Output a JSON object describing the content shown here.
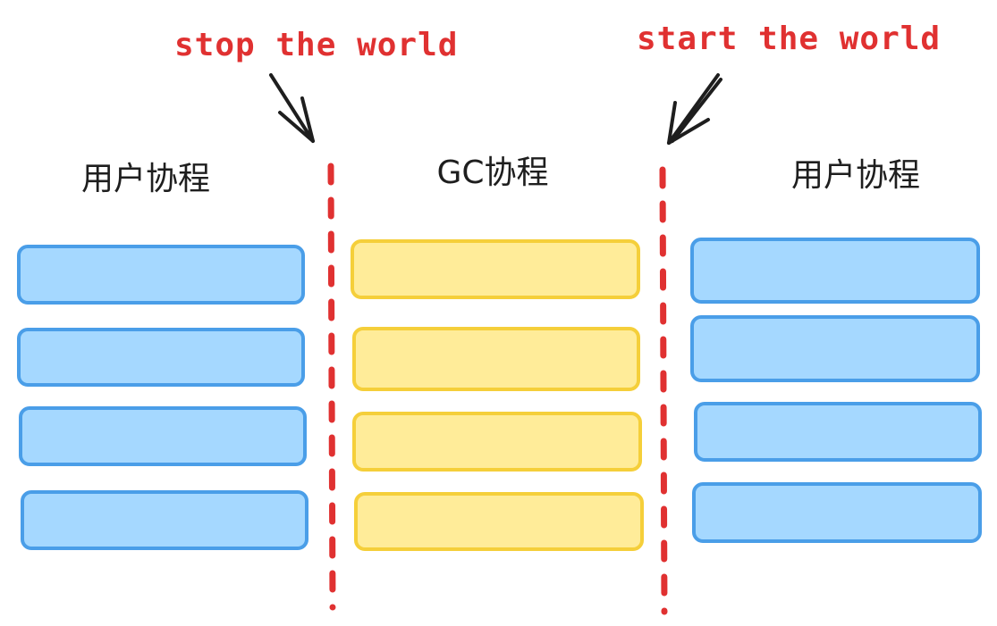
{
  "annotations": {
    "stop": "stop the world",
    "start": "start the world"
  },
  "columns": {
    "user_left": {
      "title": "用户协程"
    },
    "gc": {
      "title": "GC协程"
    },
    "user_right": {
      "title": "用户协程"
    }
  },
  "colors": {
    "annotation_text": "#e03131",
    "divider": "#e03131",
    "arrow": "#1e1e1e",
    "title_text": "#1e1e1e",
    "user_fill": "#a5d8ff",
    "user_stroke": "#4a9ee8",
    "gc_fill": "#ffec99",
    "gc_stroke": "#f5cf3a"
  }
}
